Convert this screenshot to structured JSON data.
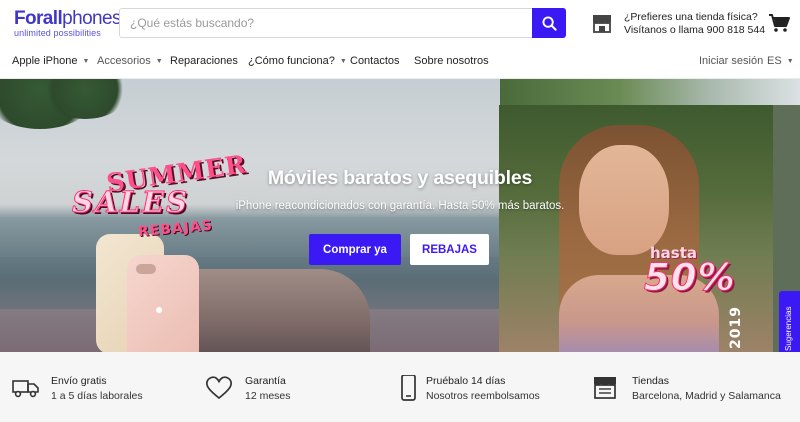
{
  "colors": {
    "brand": "#3f37c9",
    "accent": "#3b19f5",
    "promo_pink": "#ff4f8a"
  },
  "header": {
    "logo": {
      "brand_bold": "Forall",
      "brand_thin": "phones",
      "tagline": "unlimited possibilities"
    },
    "search": {
      "placeholder": "¿Qué estás buscando?",
      "button_icon": "search-icon"
    },
    "store": {
      "icon": "store-icon",
      "line1": "¿Prefieres una tienda física?",
      "line2": "Visítanos o llama 900 818 544"
    },
    "cart_icon": "cart-icon"
  },
  "nav": {
    "items": [
      {
        "label": "Apple iPhone",
        "has_caret": true
      },
      {
        "label": "Accesorios",
        "has_caret": true
      },
      {
        "label": "Reparaciones",
        "has_caret": false
      },
      {
        "label": "¿Cómo funciona?",
        "has_caret": true
      },
      {
        "label": "Contactos",
        "has_caret": false
      },
      {
        "label": "Sobre nosotros",
        "has_caret": false
      }
    ],
    "login": "Iniciar sesión",
    "language": "ES"
  },
  "hero": {
    "promo": {
      "line1": "SUMMER",
      "line2": "SALES",
      "line3": "REBAJAS"
    },
    "title": "Móviles baratos y asequibles",
    "subtitle": "iPhone reacondicionados con garantía. Hasta 50% más baratos.",
    "cta_primary": "Comprar ya",
    "cta_secondary": "REBAJAS",
    "discount": {
      "prefix": "hasta",
      "value": "50%",
      "year": "2019"
    },
    "feedback_tab": "Sugerencias"
  },
  "features": [
    {
      "icon": "truck-icon",
      "title": "Envío gratis",
      "subtitle": "1 a 5 días laborales"
    },
    {
      "icon": "heart-icon",
      "title": "Garantía",
      "subtitle": "12 meses"
    },
    {
      "icon": "phone-icon",
      "title": "Pruébalo 14 días",
      "subtitle": "Nosotros reembolsamos"
    },
    {
      "icon": "store-icon",
      "title": "Tiendas",
      "subtitle": "Barcelona, Madrid y Salamanca"
    }
  ]
}
